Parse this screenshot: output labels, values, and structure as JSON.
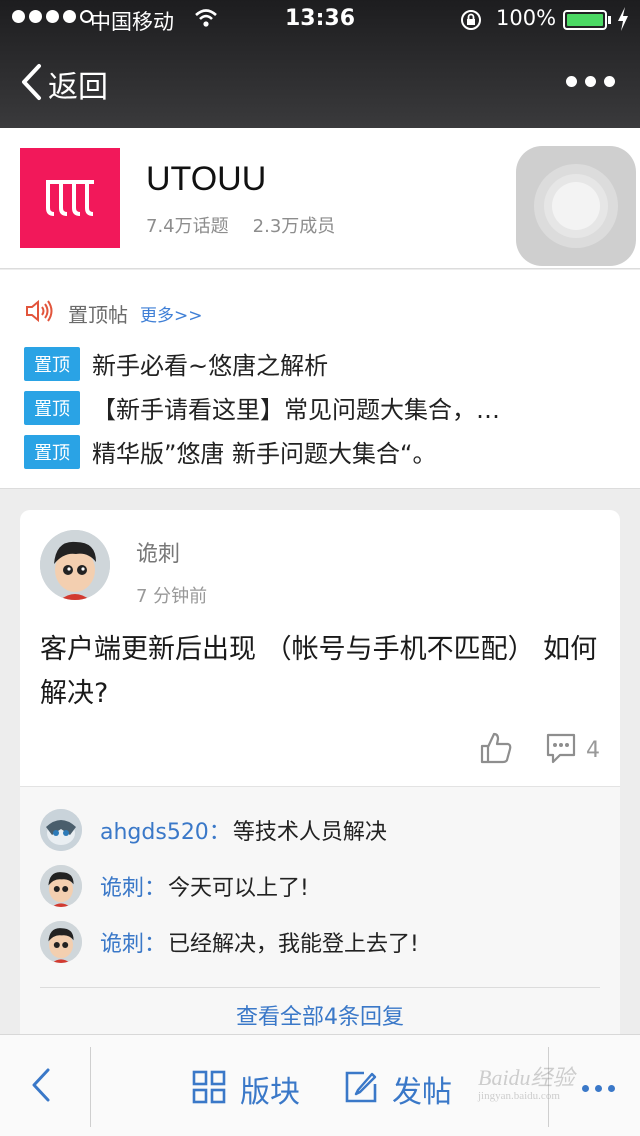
{
  "status_bar": {
    "carrier": "中国移动",
    "time": "13:36",
    "battery_pct": "100%",
    "battery_color": "#4cd964"
  },
  "nav": {
    "back_label": "返回",
    "back_icon": "chevron-left-icon",
    "more_icon": "more-dots-icon"
  },
  "forum": {
    "logo_color": "#f2185a",
    "name": "UTOUU",
    "topics": "7.4万话题",
    "members": "2.3万成员"
  },
  "pinned": {
    "title": "置顶帖",
    "more": "更多>>",
    "tag": "置顶",
    "tag_color": "#2aa3e5",
    "items": [
      {
        "text": "新手必看~悠唐之解析"
      },
      {
        "text": "【新手请看这里】常见问题大集合，…"
      },
      {
        "text": "精华版”悠唐 新手问题大集合“。"
      }
    ]
  },
  "post": {
    "author": "诡刺",
    "time": "7 分钟前",
    "title": "客户端更新后出现 （帐号与手机不匹配） 如何解决?",
    "comment_count": "4",
    "replies": [
      {
        "user": "ahgds520：",
        "text": "等技术人员解决"
      },
      {
        "user": "诡刺：",
        "text": "今天可以上了!"
      },
      {
        "user": "诡刺：",
        "text": "已经解决，我能登上去了!"
      }
    ],
    "view_all": "查看全部4条回复"
  },
  "toolbar": {
    "boards_label": "版块",
    "post_label": "发帖",
    "link_color": "#3a78c8"
  },
  "watermark": {
    "brand": "Baidu经验",
    "url": "jingyan.baidu.com"
  }
}
